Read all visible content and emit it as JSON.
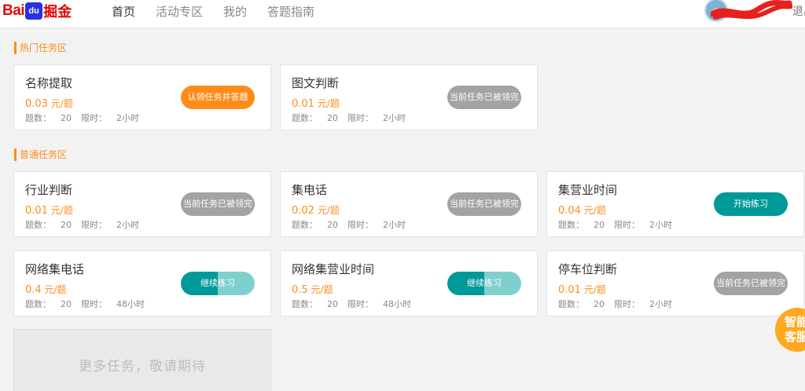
{
  "header": {
    "logo_bai": "Bai",
    "logo_du": "du",
    "logo_jue": "掘金",
    "nav": [
      "首页",
      "活动专区",
      "我的",
      "答题指南"
    ],
    "logout": "退出"
  },
  "sections": [
    {
      "title": "热门任务区"
    },
    {
      "title": "普通任务区"
    }
  ],
  "price_unit": "元/题",
  "count_prefix": "题数：",
  "limit_prefix": "限时：",
  "cards": [
    {
      "name": "名称提取",
      "price": "0.03",
      "count": "20",
      "limit": "2小时",
      "button": "认领任务并答题",
      "button_style": "orange"
    },
    {
      "name": "图文判断",
      "price": "0.01",
      "count": "20",
      "limit": "2小时",
      "button": "当前任务已被领完",
      "button_style": "gray"
    },
    {
      "name": "行业判断",
      "price": "0.01",
      "count": "20",
      "limit": "2小时",
      "button": "当前任务已被领完",
      "button_style": "gray"
    },
    {
      "name": "集电话",
      "price": "0.02",
      "count": "20",
      "limit": "2小时",
      "button": "当前任务已被领完",
      "button_style": "gray"
    },
    {
      "name": "集营业时间",
      "price": "0.04",
      "count": "20",
      "limit": "2小时",
      "button": "开始练习",
      "button_style": "teal"
    },
    {
      "name": "网络集电话",
      "price": "0.4",
      "count": "20",
      "limit": "48小时",
      "button": "继续练习",
      "button_style": "continue"
    },
    {
      "name": "网络集营业时间",
      "price": "0.5",
      "count": "20",
      "limit": "48小时",
      "button": "继续练习",
      "button_style": "continue"
    },
    {
      "name": "停车位判断",
      "price": "0.01",
      "count": "20",
      "limit": "2小时",
      "button": "当前任务已被领完",
      "button_style": "gray"
    }
  ],
  "more_tasks": "更多任务，敬请期待",
  "service": {
    "line1": "智能",
    "line2": "客服"
  },
  "colors": {
    "accent": "#ff8c1a",
    "teal": "#009999",
    "gray_button": "#a3a3a3"
  }
}
